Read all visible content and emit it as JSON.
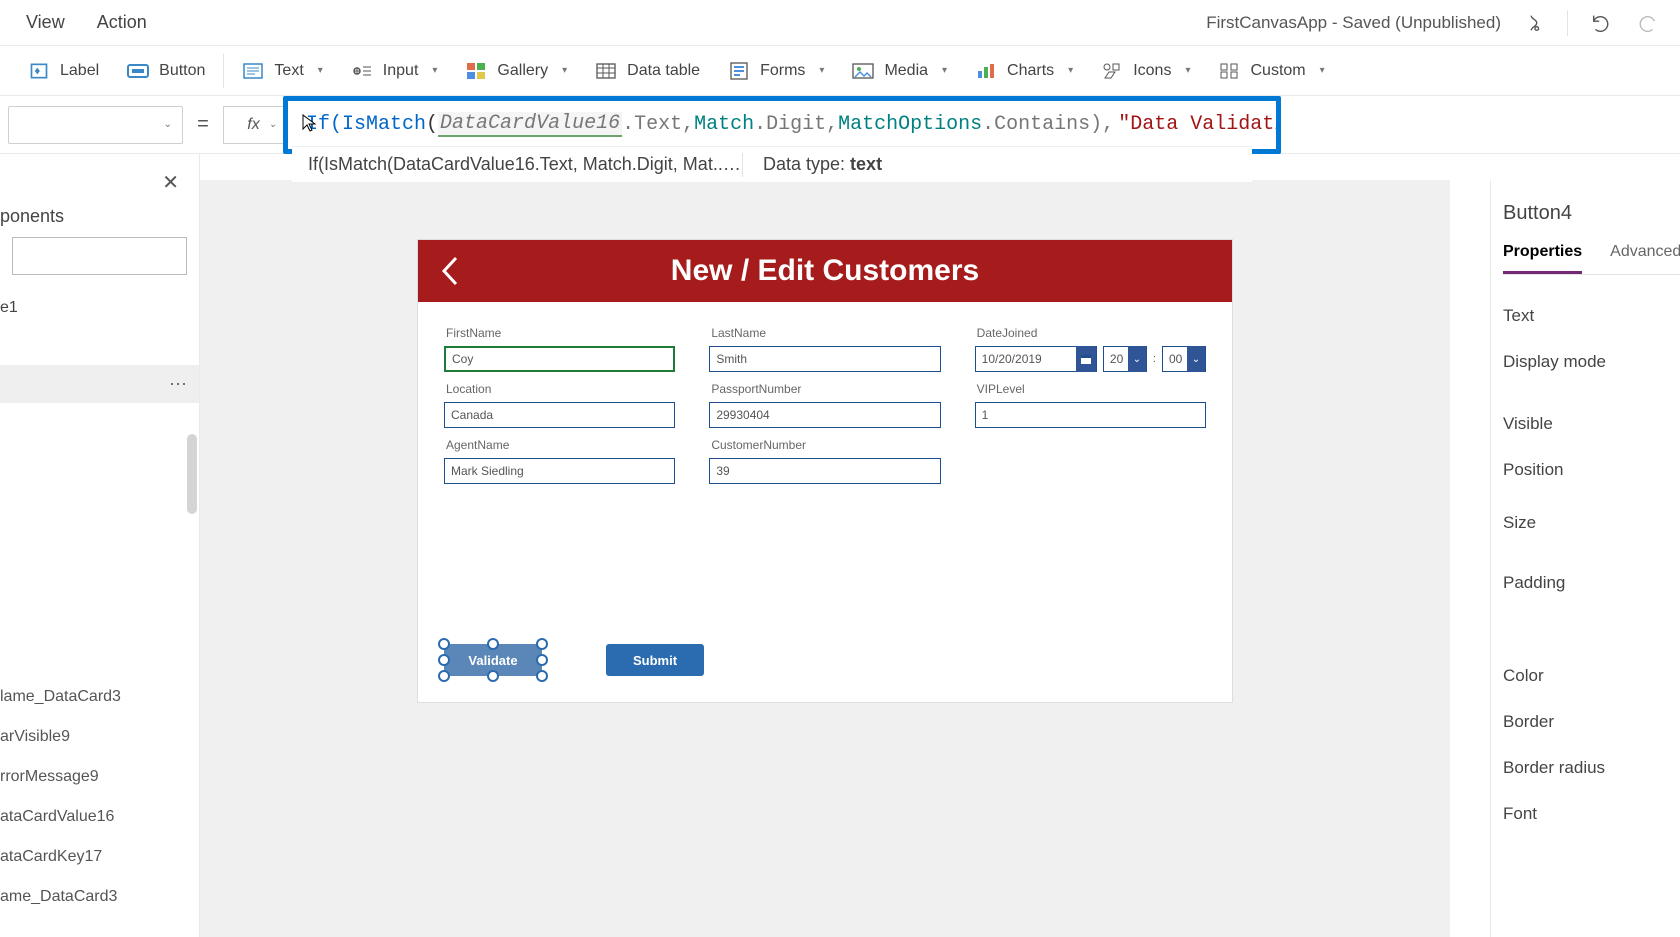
{
  "menubar": {
    "view": "View",
    "action": "Action"
  },
  "title": "FirstCanvasApp - Saved (Unpublished)",
  "ribbon": {
    "label": "Label",
    "button": "Button",
    "text": "Text",
    "input": "Input",
    "gallery": "Gallery",
    "datatable": "Data table",
    "forms": "Forms",
    "media": "Media",
    "charts": "Charts",
    "icons": "Icons",
    "custom": "Custom"
  },
  "formula": {
    "prefix": "If(",
    "fn1": "IsMatch",
    "ref": "DataCardValue16",
    "refSuffix": ".Text, ",
    "match": "Match",
    "matchSuffix": ".Digit, ",
    "matchOpt": "MatchOptions",
    "matchOptSuffix": ".Contains), ",
    "str": "\"Data Validation Error\"",
    "tail": ", \"\")",
    "summary": "If(IsMatch(DataCardValue16.Text, Match.Digit, Mat...",
    "summaryEq": "=",
    "dataTypeLabel": "Data type: ",
    "dataType": "text"
  },
  "tree": {
    "heading": "ponents",
    "item1": "e1",
    "lower": [
      "lame_DataCard3",
      "arVisible9",
      "rrorMessage9",
      "ataCardValue16",
      "ataCardKey17",
      "ame_DataCard3"
    ]
  },
  "canvasApp": {
    "headerTitle": "New / Edit Customers",
    "fields": {
      "firstName": {
        "label": "FirstName",
        "value": "Coy"
      },
      "lastName": {
        "label": "LastName",
        "value": "Smith"
      },
      "dateJoined": {
        "label": "DateJoined",
        "value": "10/20/2019",
        "hour": "20",
        "min": "00"
      },
      "location": {
        "label": "Location",
        "value": "Canada"
      },
      "passport": {
        "label": "PassportNumber",
        "value": "29930404"
      },
      "vip": {
        "label": "VIPLevel",
        "value": "1"
      },
      "agent": {
        "label": "AgentName",
        "value": "Mark Siedling"
      },
      "customerNo": {
        "label": "CustomerNumber",
        "value": "39"
      }
    },
    "buttons": {
      "validate": "Validate",
      "submit": "Submit"
    }
  },
  "propsPanel": {
    "name": "Button4",
    "tabs": {
      "properties": "Properties",
      "advanced": "Advanced"
    },
    "rows": [
      "Text",
      "Display mode"
    ],
    "rows2": [
      "Visible",
      "Position",
      "Size",
      "Padding"
    ],
    "rows3": [
      "Color",
      "Border",
      "Border radius",
      "Font"
    ]
  }
}
